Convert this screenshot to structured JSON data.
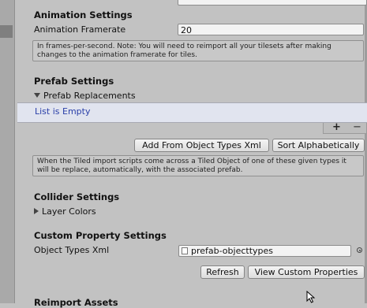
{
  "animation": {
    "header": "Animation Settings",
    "framerate_label": "Animation Framerate",
    "framerate_value": "20",
    "help": "In frames-per-second. Note: You will need to reimport all your tilesets after making changes to the animation framerate for tiles."
  },
  "prefab": {
    "header": "Prefab Settings",
    "replacements_label": "Prefab Replacements",
    "list_empty": "List is Empty",
    "add_symbol": "+",
    "remove_symbol": "−",
    "add_from_xml_button": "Add From Object Types Xml",
    "sort_button": "Sort Alphabetically",
    "help": "When the Tiled import scripts come across a Tiled Object of one of these given types it will be replace, automatically, with the associated prefab."
  },
  "collider": {
    "header": "Collider Settings",
    "layer_colors_label": "Layer Colors"
  },
  "custom": {
    "header": "Custom Property Settings",
    "object_types_label": "Object Types Xml",
    "object_types_value": "prefab-objecttypes",
    "refresh_button": "Refresh",
    "view_button": "View Custom Properties"
  },
  "reimport": {
    "header": "Reimport Assets"
  },
  "icons": {
    "foldout_open": "triangle-down-icon",
    "foldout_closed": "triangle-right-icon",
    "file": "text-asset-icon",
    "picker": "object-picker-icon",
    "cursor": "mouse-pointer-icon"
  }
}
